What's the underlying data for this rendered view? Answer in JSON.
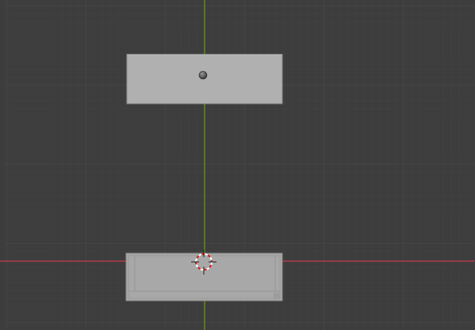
{
  "viewport": {
    "view_mode": "orthographic",
    "background_color": "#3d3d3d",
    "grid_minor_color": "#444444",
    "grid_major_color": "#4a4a4a",
    "axis_x_color": "#c93a4f",
    "axis_z_color": "#6a9a2a"
  },
  "objects": [
    {
      "name": "upper-box",
      "color": "#b0b0b0",
      "has_origin_point": true
    },
    {
      "name": "lower-box",
      "color": "#a8a8a8",
      "has_origin_point": false
    }
  ],
  "cursor_3d": {
    "visible": true,
    "ring_colors": [
      "#d02020",
      "#ffffff"
    ]
  }
}
